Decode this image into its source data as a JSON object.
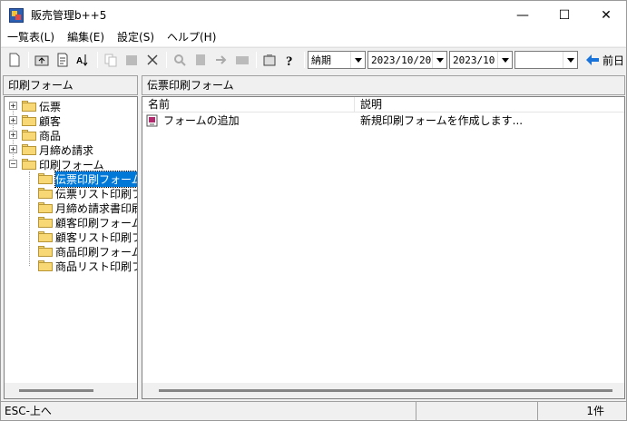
{
  "window": {
    "title": "販売管理b++5",
    "minimize_glyph": "—",
    "maximize_glyph": "☐",
    "close_glyph": "✕"
  },
  "menu": [
    {
      "label": "一覧表(L)"
    },
    {
      "label": "編集(E)"
    },
    {
      "label": "設定(S)"
    },
    {
      "label": "ヘルプ(H)"
    }
  ],
  "toolbar": {
    "combo_type": "納期",
    "combo_date": "2023/10/20",
    "combo_month": "2023/10",
    "combo_empty": "",
    "prev_label": "前日"
  },
  "left_panel": {
    "header": "印刷フォーム",
    "tree": [
      {
        "label": "伝票",
        "expander": "+"
      },
      {
        "label": "顧客",
        "expander": "+"
      },
      {
        "label": "商品",
        "expander": "+"
      },
      {
        "label": "月締め請求",
        "expander": "+"
      },
      {
        "label": "印刷フォーム",
        "expander": "−"
      },
      {
        "label": "伝票印刷フォーム"
      },
      {
        "label": "伝票リスト印刷フォーム"
      },
      {
        "label": "月締め請求書印刷"
      },
      {
        "label": "顧客印刷フォーム"
      },
      {
        "label": "顧客リスト印刷フォーム"
      },
      {
        "label": "商品印刷フォーム"
      },
      {
        "label": "商品リスト印刷フォーム"
      }
    ]
  },
  "right_panel": {
    "header": "伝票印刷フォーム",
    "columns": [
      "名前",
      "説明"
    ],
    "rows": [
      {
        "name": "フォームの追加",
        "desc": "新規印刷フォームを作成します..."
      }
    ]
  },
  "status": {
    "hint": "ESC-上へ",
    "count": "1件"
  }
}
